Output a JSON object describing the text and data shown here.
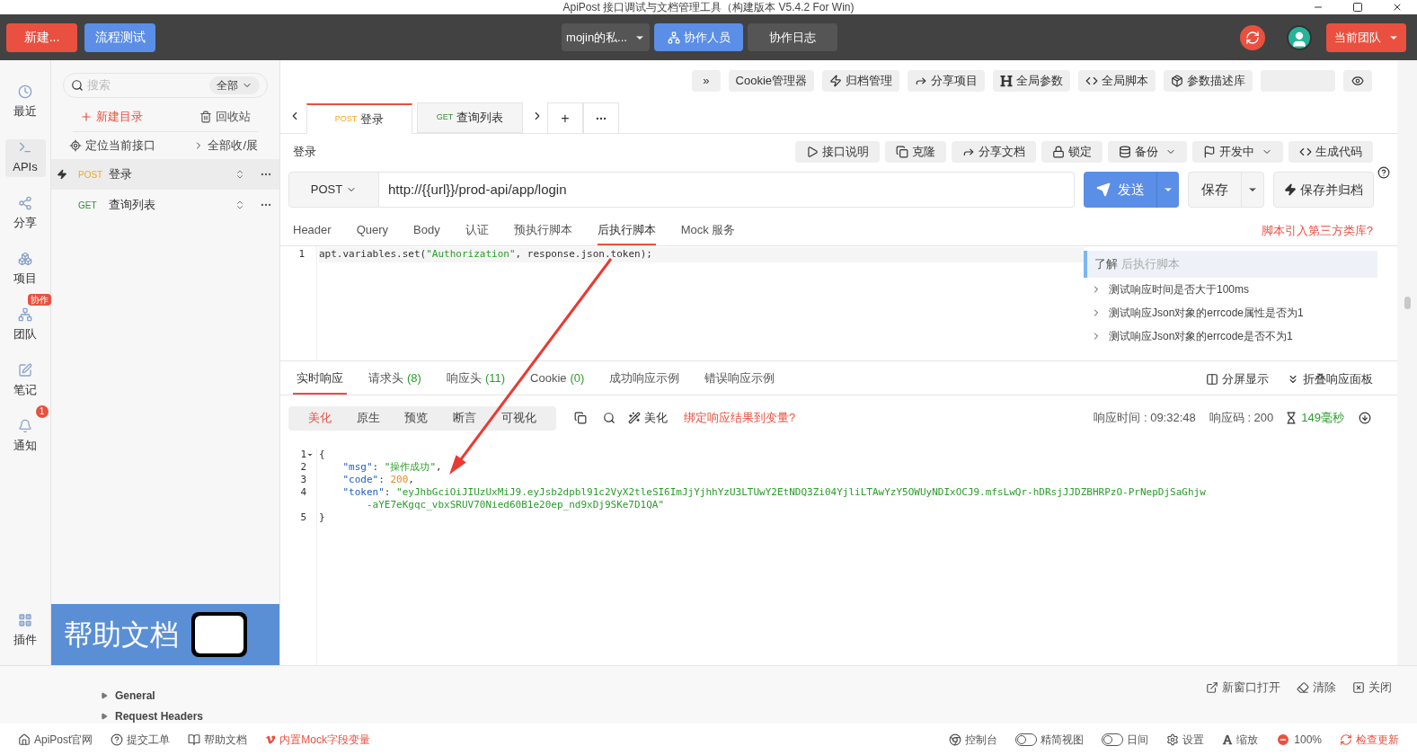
{
  "window": {
    "title": "ApiPost 接口调试与文档管理工具（构建版本 V5.4.2 For Win)"
  },
  "topbar": {
    "new_button": "新建...",
    "flow_button": "流程测试",
    "project": "mojin的私...",
    "collab": "协作人员",
    "log": "协作日志",
    "team": "当前团队"
  },
  "rail": [
    {
      "label": "最近",
      "selected": false
    },
    {
      "label": "APIs",
      "selected": true
    },
    {
      "label": "分享",
      "selected": false
    },
    {
      "label": "项目",
      "selected": false
    },
    {
      "label": "团队",
      "selected": false,
      "tag": "协作"
    },
    {
      "label": "笔记",
      "selected": false
    },
    {
      "label": "通知",
      "selected": false,
      "count": "1"
    }
  ],
  "rail_bottom": {
    "label": "插件"
  },
  "sidebar": {
    "search_placeholder": "搜索",
    "filter": "全部",
    "new_folder": "新建目录",
    "recycle": "回收站",
    "locate": "定位当前接口",
    "collapse": "全部收/展",
    "items": [
      {
        "method": "POST",
        "name": "登录",
        "selected": true
      },
      {
        "method": "GET",
        "name": "查询列表",
        "selected": false
      }
    ],
    "banner": "帮助文档"
  },
  "toolbar": [
    "»",
    "Cookie管理器",
    "归档管理",
    "分享项目",
    "全局参数",
    "全局脚本",
    "参数描述库"
  ],
  "tabs": [
    {
      "method": "POST",
      "name": "登录",
      "selected": true
    },
    {
      "method": "GET",
      "name": "查询列表",
      "selected": false
    }
  ],
  "add_tab": "+",
  "request": {
    "title": "登录",
    "actions": [
      {
        "label": "接口说明",
        "dropdown": false
      },
      {
        "label": "克隆",
        "dropdown": false
      },
      {
        "label": "分享文档",
        "dropdown": false
      },
      {
        "label": "锁定",
        "dropdown": false
      },
      {
        "label": "备份",
        "dropdown": true
      },
      {
        "label": "开发中",
        "dropdown": true
      },
      {
        "label": "生成代码",
        "dropdown": false
      }
    ],
    "method": "POST",
    "url": "http://{{url}}/prod-api/app/login",
    "send": "发送",
    "save": "保存",
    "save_archive": "保存并归档",
    "tabs": [
      {
        "label": "Header",
        "selected": false
      },
      {
        "label": "Query",
        "selected": false
      },
      {
        "label": "Body",
        "selected": false
      },
      {
        "label": "认证",
        "selected": false
      },
      {
        "label": "预执行脚本",
        "selected": false
      },
      {
        "label": "后执行脚本",
        "selected": true
      },
      {
        "label": "Mock 服务",
        "selected": false
      }
    ],
    "lib_link": "脚本引入第三方类库?",
    "script": [
      {
        "number": "1",
        "tokens": [
          {
            "kind": "plain",
            "text": "apt.variables.set("
          },
          {
            "kind": "str",
            "text": "\"Authorization\""
          },
          {
            "kind": "plain",
            "text": ", response.json.token);"
          }
        ]
      }
    ],
    "help": {
      "title": "了解",
      "subtitle": "后执行脚本",
      "items": [
        "测试响应时间是否大于100ms",
        "测试响应Json对象的errcode属性是否为1",
        "测试响应Json对象的errcode是否不为1"
      ]
    }
  },
  "response": {
    "tabs": [
      {
        "label": "实时响应",
        "selected": true
      },
      {
        "label": "请求头",
        "count": "(8)",
        "selected": false
      },
      {
        "label": "响应头",
        "count": "(11)",
        "selected": false
      },
      {
        "label": "Cookie",
        "count": "(0)",
        "selected": false
      },
      {
        "label": "成功响应示例",
        "selected": false
      },
      {
        "label": "错误响应示例",
        "selected": false
      }
    ],
    "split": "分屏显示",
    "fold": "折叠响应面板",
    "modes": [
      {
        "label": "美化",
        "selected": true
      },
      {
        "label": "原生",
        "selected": false
      },
      {
        "label": "预览",
        "selected": false
      },
      {
        "label": "断言",
        "selected": false
      },
      {
        "label": "可视化",
        "selected": false
      }
    ],
    "beautify": "美化",
    "bind": "绑定响应结果到变量?",
    "time": "响应时间 : 09:32:48",
    "code": "响应码 : 200",
    "duration": "149毫秒",
    "lines": [
      {
        "number": "1",
        "expanded": true,
        "tokens": [
          {
            "kind": "plain",
            "text": "{"
          }
        ]
      },
      {
        "number": "2",
        "tokens": [
          {
            "kind": "key",
            "text": "    \"msg\""
          },
          {
            "kind": "plain",
            "text": ": "
          },
          {
            "kind": "str",
            "text": "\"操作成功\""
          },
          {
            "kind": "plain",
            "text": ","
          }
        ]
      },
      {
        "number": "3",
        "tokens": [
          {
            "kind": "key",
            "text": "    \"code\""
          },
          {
            "kind": "plain",
            "text": ": "
          },
          {
            "kind": "num",
            "text": "200"
          },
          {
            "kind": "plain",
            "text": ","
          }
        ]
      },
      {
        "number": "4",
        "tokens": [
          {
            "kind": "key",
            "text": "    \"token\""
          },
          {
            "kind": "plain",
            "text": ": "
          },
          {
            "kind": "str",
            "text": "\"eyJhbGciOiJIUzUxMiJ9.eyJsb2dpbl91c2VyX2tleSI6ImJjYjhhYzU3LTUwY2EtNDQ3Zi04YjliLTAwYzY5OWUyNDIxOCJ9.mfsLwQr-hDRsjJJDZBHRPzO-PrNepDjSaGhjw"
          }
        ]
      },
      {
        "tokens": [
          {
            "kind": "str",
            "text": "        -aYE7eKgqc_vbxSRUV70Nied60B1e20ep_nd9xDj9SKe7D1QA\""
          }
        ]
      },
      {
        "number": "5",
        "tokens": [
          {
            "kind": "plain",
            "text": "}"
          }
        ]
      }
    ]
  },
  "bottom_panel": {
    "actions": [
      "新窗口打开",
      "清除",
      "关闭"
    ],
    "tree": [
      "General",
      "Request Headers"
    ]
  },
  "status_bar": {
    "left": [
      {
        "label": "ApiPost官网",
        "kind": "home"
      },
      {
        "label": "提交工单",
        "kind": "help"
      },
      {
        "label": "帮助文档",
        "kind": "book"
      },
      {
        "label": "内置Mock字段变量",
        "kind": "mock"
      }
    ],
    "right": [
      {
        "label": "控制台",
        "kind": "console"
      },
      {
        "label": "精简视图",
        "kind": "toggle",
        "on": false
      },
      {
        "label": "日间",
        "kind": "toggle",
        "on": false
      },
      {
        "label": "设置",
        "kind": "settings"
      },
      {
        "label": "缩放",
        "kind": "zoom"
      },
      {
        "label": "100%",
        "kind": "zoomout"
      },
      {
        "label": "检查更新",
        "kind": "update"
      }
    ]
  }
}
